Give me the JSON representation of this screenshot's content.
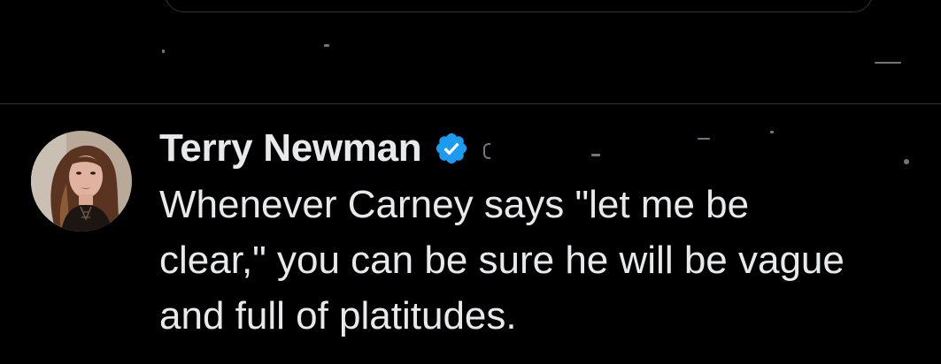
{
  "colors": {
    "background": "#000000",
    "text_primary": "#e7e9ea",
    "text_secondary": "#71767b",
    "border": "#2f3336",
    "verified_blue": "#1d9bf0"
  },
  "tweet": {
    "author": {
      "display_name": "Terry Newman",
      "verified_icon": "verified-badge-icon",
      "avatar_icon": "profile-photo"
    },
    "text": "Whenever Carney says \"let me be\nclear,\" you can be sure he will be vague\nand full of platitudes."
  },
  "icons": {
    "more": "more-options-icon"
  }
}
